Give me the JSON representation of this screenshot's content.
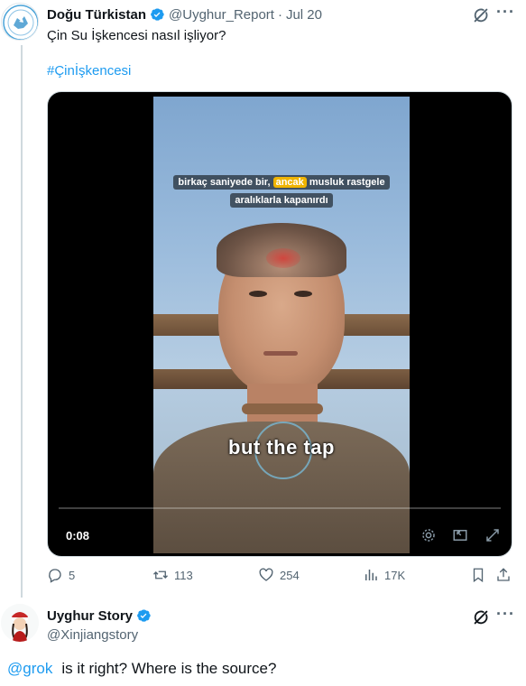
{
  "tweet": {
    "author_name": "Doğu Türkistan",
    "handle": "@Uyghur_Report",
    "separator": "·",
    "date": "Jul 20",
    "text": "Çin Su İşkencesi nasıl işliyor?",
    "hashtag": "#Çinİşkencesi",
    "video": {
      "subtitle_before": "birkaç saniyede bir,",
      "subtitle_highlight": "ancak",
      "subtitle_after": "musluk rastgele",
      "subtitle_line2": "aralıklarla kapanırdı",
      "caption": "but the tap",
      "time": "0:08"
    },
    "stats": {
      "replies": "5",
      "retweets": "113",
      "likes": "254",
      "views": "17K"
    },
    "icons": [
      "grok-icon",
      "more-icon",
      "reply-icon",
      "retweet-icon",
      "like-icon",
      "views-icon",
      "bookmark-icon",
      "settings-icon",
      "fullscreen-icon"
    ]
  },
  "reply": {
    "author_name": "Uyghur Story",
    "handle": "@Xinjiangstory",
    "mention": "@grok",
    "text": "is it right? Where is the source?"
  },
  "colors": {
    "accent": "#1d9bf0",
    "secondary_text": "#536471",
    "verified": "#1d9bf0",
    "highlight": "#f0b400"
  }
}
